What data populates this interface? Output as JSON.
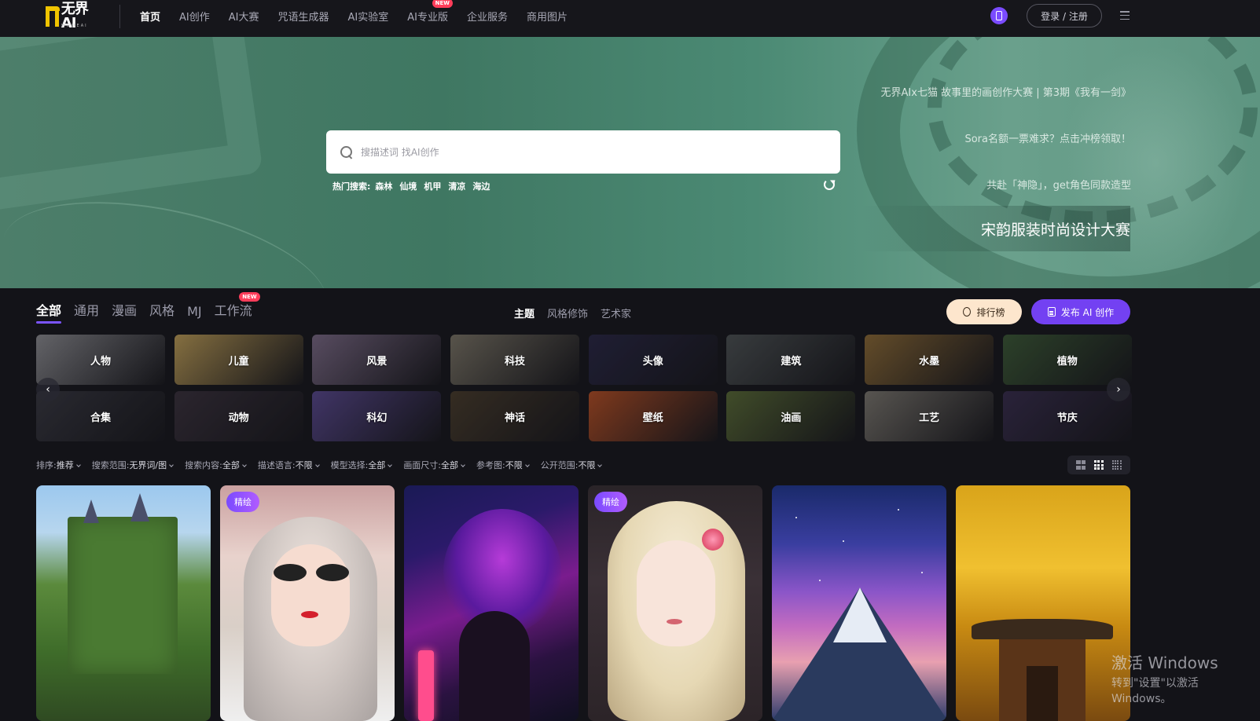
{
  "brand": {
    "name": "无界AI",
    "subtitle": "WUJIEAI"
  },
  "nav": {
    "items": [
      {
        "label": "首页",
        "active": true
      },
      {
        "label": "AI创作"
      },
      {
        "label": "AI大赛"
      },
      {
        "label": "咒语生成器"
      },
      {
        "label": "AI实验室"
      },
      {
        "label": "AI专业版",
        "badge": "NEW"
      },
      {
        "label": "企业服务"
      },
      {
        "label": "商用图片"
      }
    ],
    "login_label": "登录 / 注册",
    "phone_icon": "mobile-phone-icon",
    "menu_icon": "hamburger-menu-icon"
  },
  "hero": {
    "search": {
      "placeholder": "搜描述词 找AI创作"
    },
    "hot_label": "热门搜索:",
    "hot_tags": [
      "森林",
      "仙境",
      "机甲",
      "清凉",
      "海边"
    ],
    "banners": [
      "无界AIx七猫 故事里的画创作大赛 | 第3期《我有一剑》",
      "Sora名额一票难求？点击冲榜领取！",
      "共赴「神隐」，get角色同款造型",
      "宋韵服装时尚设计大赛"
    ]
  },
  "category_tabs": [
    {
      "label": "全部",
      "active": true
    },
    {
      "label": "通用"
    },
    {
      "label": "漫画"
    },
    {
      "label": "风格"
    },
    {
      "label": "MJ"
    },
    {
      "label": "工作流",
      "badge": "NEW"
    }
  ],
  "sub_tabs": [
    {
      "label": "主题",
      "active": true
    },
    {
      "label": "风格修饰"
    },
    {
      "label": "艺术家"
    }
  ],
  "actions": {
    "rank_label": "排行榜",
    "publish_label": "发布 AI 创作"
  },
  "themes": [
    {
      "label": "人物",
      "bg": "#8a8a90"
    },
    {
      "label": "儿童",
      "bg": "#b89a5a"
    },
    {
      "label": "风景",
      "bg": "#7a6a86"
    },
    {
      "label": "科技",
      "bg": "#7a7468"
    },
    {
      "label": "头像",
      "bg": "#2c2a48"
    },
    {
      "label": "建筑",
      "bg": "#4e5356"
    },
    {
      "label": "水墨",
      "bg": "#8a6a3a"
    },
    {
      "label": "植物",
      "bg": "#3e5a3a"
    },
    {
      "label": "合集",
      "bg": "#3a3a44"
    },
    {
      "label": "动物",
      "bg": "#3c3440"
    },
    {
      "label": "科幻",
      "bg": "#5a4a8e"
    },
    {
      "label": "神话",
      "bg": "#4a3e30"
    },
    {
      "label": "壁纸",
      "bg": "#b0502a"
    },
    {
      "label": "油画",
      "bg": "#5a6a3a"
    },
    {
      "label": "工艺",
      "bg": "#7a7670"
    },
    {
      "label": "节庆",
      "bg": "#3a3050"
    }
  ],
  "filters": [
    {
      "label": "排序:",
      "value": "推荐"
    },
    {
      "label": "搜索范围:",
      "value": "无界词/图"
    },
    {
      "label": "搜索内容:",
      "value": "全部"
    },
    {
      "label": "描述语言:",
      "value": "不限"
    },
    {
      "label": "模型选择:",
      "value": "全部"
    },
    {
      "label": "画面尺寸:",
      "value": "全部"
    },
    {
      "label": "参考图:",
      "value": "不限"
    },
    {
      "label": "公开范围:",
      "value": "不限"
    }
  ],
  "gallery": [
    {
      "badge": ""
    },
    {
      "badge": "精绘"
    },
    {
      "badge": ""
    },
    {
      "badge": "精绘"
    },
    {
      "badge": ""
    },
    {
      "badge": ""
    }
  ],
  "watermark": {
    "line1": "激活 Windows",
    "line2": "转到\"设置\"以激活 Windows。"
  }
}
